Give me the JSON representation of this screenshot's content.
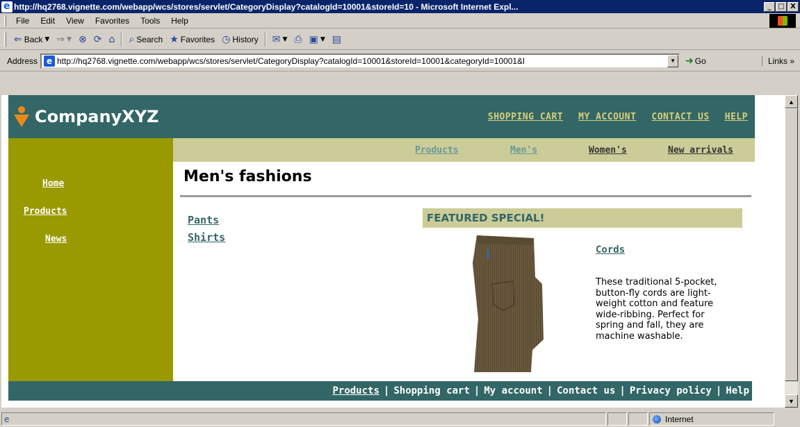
{
  "window": {
    "title": "http://hq2768.vignette.com/webapp/wcs/stores/servlet/CategoryDisplay?catalogId=10001&storeId=10 - Microsoft Internet Expl...",
    "min": "_",
    "max": "□",
    "close": "X"
  },
  "menubar": [
    "File",
    "Edit",
    "View",
    "Favorites",
    "Tools",
    "Help"
  ],
  "toolbar": {
    "back": "Back",
    "search": "Search",
    "favorites": "Favorites",
    "history": "History"
  },
  "address": {
    "label": "Address",
    "url": "http://hq2768.vignette.com/webapp/wcs/stores/servlet/CategoryDisplay?catalogId=10001&storeId=10001&categoryId=10001&l",
    "go": "Go",
    "links": "Links"
  },
  "site": {
    "logo": "CompanyXYZ",
    "topnav": [
      "SHOPPING CART",
      "MY ACCOUNT",
      "CONTACT US",
      "HELP"
    ],
    "sidebar": [
      "Home",
      "Products",
      "News"
    ],
    "subnav": [
      "Products",
      "Men's",
      "Women's",
      "New arrivals"
    ],
    "heading": "Men's fashions",
    "categories": [
      "Pants",
      "Shirts"
    ],
    "featured": {
      "label": "FEATURED SPECIAL!",
      "title": "Cords",
      "description": "These traditional 5-pocket, button-fly cords are light-weight cotton and feature wide-ribbing. Perfect for spring and fall, they are machine washable."
    },
    "footer": [
      "Products",
      "Shopping cart",
      "My account",
      "Contact us",
      "Privacy policy",
      "Help"
    ]
  },
  "status": {
    "zone": "Internet"
  },
  "colors": {
    "header": "#336666",
    "sidebar": "#999900",
    "subnav": "#cccc99"
  }
}
